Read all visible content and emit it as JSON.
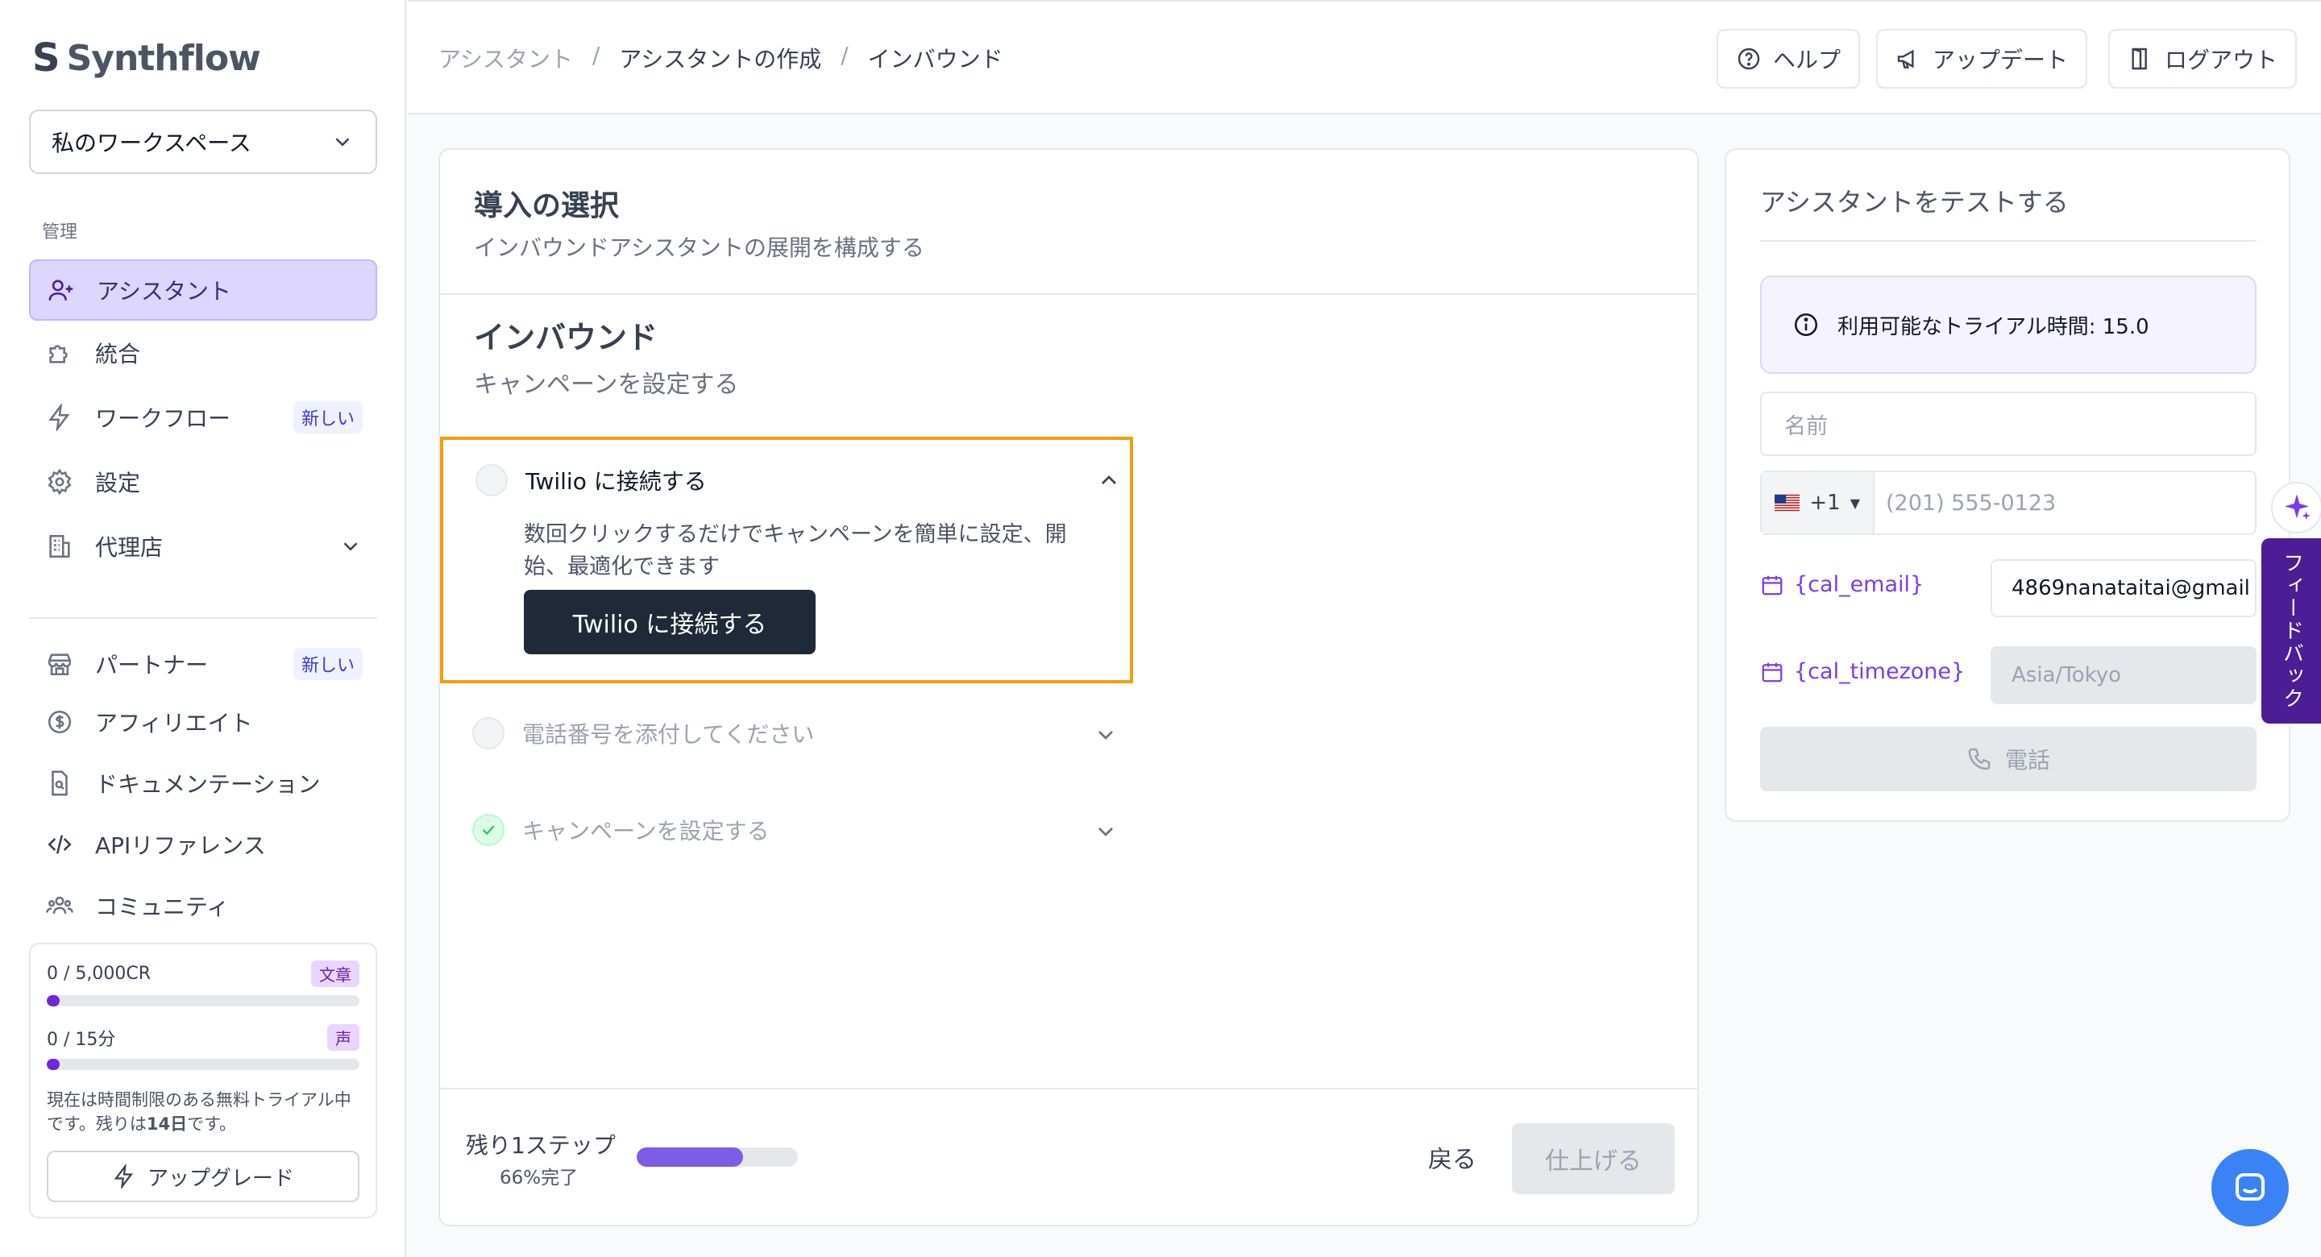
{
  "sidebar": {
    "logo_mark": "S",
    "logo_text": "Synthflow",
    "workspace": "私のワークスペース",
    "section_label": "管理",
    "items": [
      {
        "label": "アシスタント"
      },
      {
        "label": "統合"
      },
      {
        "label": "ワークフロー",
        "badge": "新しい"
      },
      {
        "label": "設定"
      },
      {
        "label": "代理店"
      }
    ],
    "items2": [
      {
        "label": "パートナー",
        "badge": "新しい"
      },
      {
        "label": "アフィリエイト"
      },
      {
        "label": "ドキュメンテーション"
      },
      {
        "label": "APIリファレンス"
      },
      {
        "label": "コミュニティ"
      }
    ],
    "usage": {
      "text_used": "0",
      "text_total": "5,000CR",
      "text_tag": "文章",
      "text_fraction": 0.02,
      "voice_used": "0",
      "voice_total": "15分",
      "voice_tag": "声",
      "voice_fraction": 0.02,
      "note_a": "現在は時間制限のある無料トライアル中です。残りは",
      "note_days": "14日",
      "note_b": "です。",
      "upgrade_label": "アップグレード"
    }
  },
  "header": {
    "breadcrumbs": [
      "アシスタント",
      "アシスタントの作成",
      "インバウンド"
    ],
    "help": "ヘルプ",
    "updates": "アップデート",
    "logout": "ログアウト"
  },
  "main": {
    "title": "導入の選択",
    "subtitle": "インバウンドアシスタントの展開を構成する",
    "section_title": "インバウンド",
    "section_subtitle": "キャンペーンを設定する",
    "steps": [
      {
        "title": "Twilio に接続する",
        "desc": "数回クリックするだけでキャンペーンを簡単に設定、開始、最適化できます",
        "button": "Twilio に接続する"
      },
      {
        "title": "電話番号を添付してください"
      },
      {
        "title": "キャンペーンを設定する"
      }
    ],
    "footer": {
      "remaining": "残り1ステップ",
      "percent_label": "66%完了",
      "progress": 0.66,
      "back": "戻る",
      "finish": "仕上げる"
    }
  },
  "test": {
    "title": "アシスタントをテストする",
    "trial": "利用可能なトライアル時間: 15.0",
    "name_placeholder": "名前",
    "country_code": "+1",
    "phone_placeholder": "(201) 555-0123",
    "cal_email_label": "{cal_email}",
    "cal_email_value": "4869nanataitai@gmail",
    "cal_tz_label": "{cal_timezone}",
    "cal_tz_value": "Asia/Tokyo",
    "call_label": "電話"
  },
  "float": {
    "vertical_tab": "フィードバック"
  },
  "colors": {
    "accent": "#7c3aed",
    "highlight": "#f59e0b",
    "primary_button": "#1f2937"
  }
}
